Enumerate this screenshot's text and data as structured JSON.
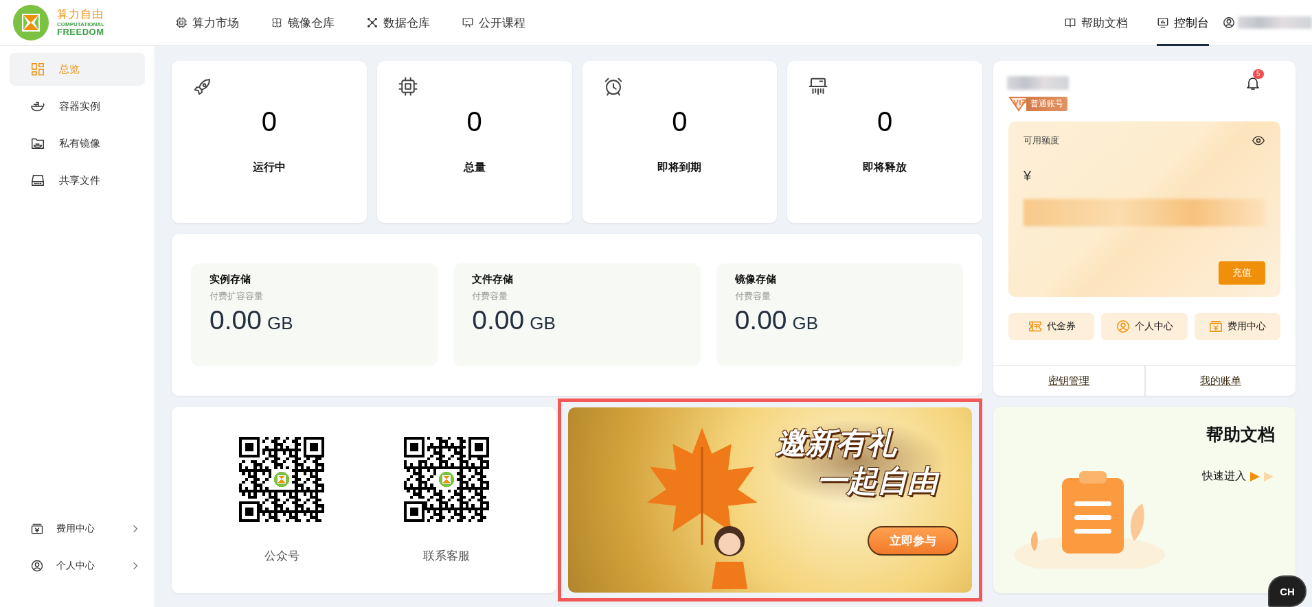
{
  "header": {
    "logo": {
      "name": "算力自由",
      "line_1": "COMPUTATIONAL",
      "line_2": "FREEDOM"
    },
    "nav": [
      {
        "label": "算力市场"
      },
      {
        "label": "镜像仓库"
      },
      {
        "label": "数据仓库"
      },
      {
        "label": "公开课程"
      }
    ],
    "right_nav": [
      {
        "label": "帮助文档",
        "selected": false
      },
      {
        "label": "控制台",
        "selected": true
      }
    ]
  },
  "sidebar": {
    "items": [
      {
        "label": "总览",
        "selected": true
      },
      {
        "label": "容器实例",
        "selected": false
      },
      {
        "label": "私有镜像",
        "selected": false
      },
      {
        "label": "共享文件",
        "selected": false
      }
    ],
    "bottom_items": [
      {
        "label": "费用中心"
      },
      {
        "label": "个人中心"
      }
    ]
  },
  "stats": [
    {
      "value": "0",
      "label": "运行中"
    },
    {
      "value": "0",
      "label": "总量"
    },
    {
      "value": "0",
      "label": "即将到期"
    },
    {
      "value": "0",
      "label": "即将释放"
    }
  ],
  "storage": [
    {
      "title": "实例存储",
      "subtitle": "付费扩容容量",
      "value": "0.00",
      "unit": "GB"
    },
    {
      "title": "文件存储",
      "subtitle": "付费容量",
      "value": "0.00",
      "unit": "GB"
    },
    {
      "title": "镜像存储",
      "subtitle": "付费容量",
      "value": "0.00",
      "unit": "GB"
    }
  ],
  "qr_codes": [
    {
      "label": "公众号"
    },
    {
      "label": "联系客服"
    }
  ],
  "banner": {
    "lines": [
      "邀新有礼",
      "一起自由"
    ],
    "button": "立即参与"
  },
  "help_card": {
    "title": "帮助文档",
    "link": "快速进入"
  },
  "account": {
    "notification_count": "5",
    "tier": "普通账号",
    "balance_label": "可用额度",
    "currency": "¥",
    "recharge_button": "充值",
    "shortcuts": [
      {
        "label": "代金券"
      },
      {
        "label": "个人中心"
      },
      {
        "label": "费用中心"
      }
    ],
    "links": [
      "密钥管理",
      "我的账单"
    ]
  },
  "chat_widget": {
    "label": "CH"
  }
}
